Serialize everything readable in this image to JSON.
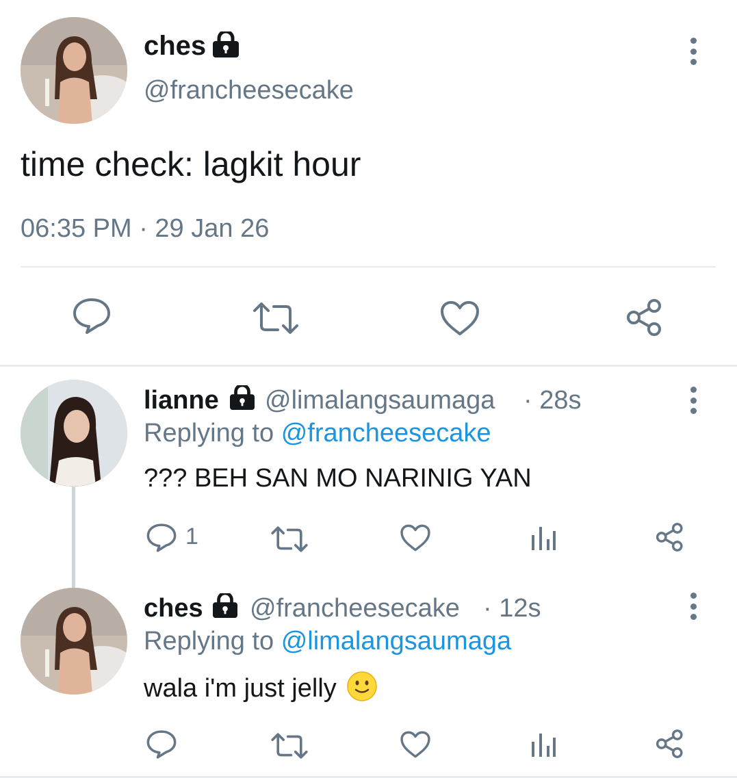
{
  "main_tweet": {
    "display_name": "ches",
    "handle": "@francheesecake",
    "text": "time check: lagkit hour",
    "timestamp": "06:35 PM · 29 Jan 26",
    "actions": [
      "reply-icon",
      "retweet-icon",
      "like-icon",
      "share-icon"
    ]
  },
  "replies": [
    {
      "display_name": "lianne",
      "handle": "@limalangsaumaga",
      "time": "· 28s",
      "replying_prefix": "Replying to",
      "replying_handle": "@francheesecake",
      "text": "??? BEH SAN MO NARINIG YAN",
      "reply_count": "1"
    },
    {
      "display_name": "ches",
      "handle": "@francheesecake",
      "time": "· 12s",
      "replying_prefix": "Replying to",
      "replying_handle": "@limalangsaumaga",
      "text": "wala i'm just jelly",
      "emoji": "🙂",
      "reply_count": ""
    }
  ],
  "colors": {
    "text": "#14171a",
    "muted": "#657786",
    "link": "#1b95e0",
    "divider": "#e6ecf0"
  }
}
